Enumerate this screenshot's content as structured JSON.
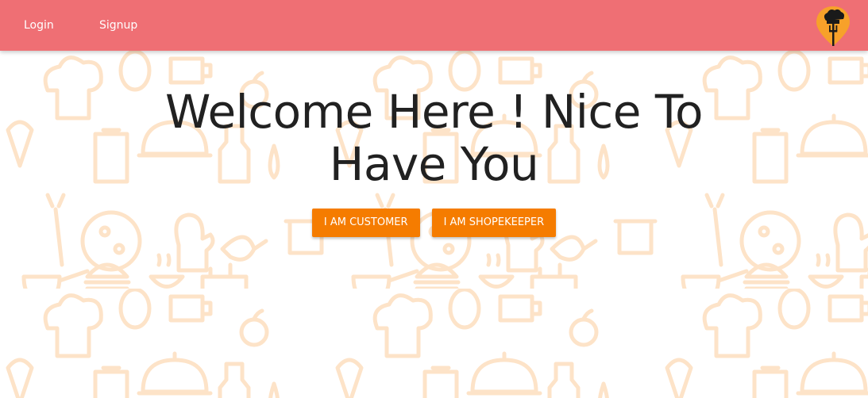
{
  "nav": {
    "links": [
      {
        "label": "Login"
      },
      {
        "label": "Signup"
      }
    ],
    "logo_icon": "chef-hat-fork-pin-icon",
    "background_color": "#ef6f74"
  },
  "hero": {
    "title": "Welcome Here ! Nice To Have You"
  },
  "buttons": {
    "customer_label": "I AM CUSTOMER",
    "shopkeeper_label": "I AM SHOPEKEEPER",
    "color": "#f57c00"
  },
  "background": {
    "pattern_icon": "food-doodle-pattern",
    "pattern_color": "#fde3c8"
  }
}
